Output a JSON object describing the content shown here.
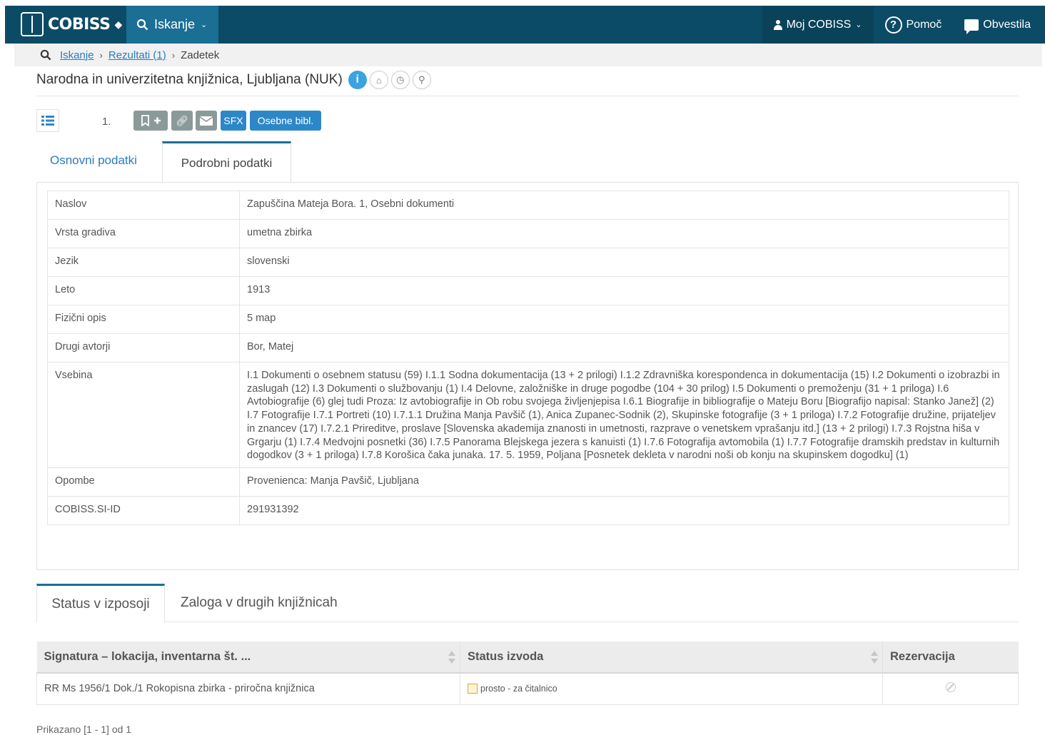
{
  "nav": {
    "brand": "COBISS",
    "search_label": "Iskanje",
    "moj_cobiss": "Moj COBISS",
    "help": "Pomoč",
    "news": "Obvestila"
  },
  "breadcrumb": {
    "items": [
      "Iskanje",
      "Rezultati (1)",
      "Zadetek"
    ]
  },
  "library": {
    "name": "Narodna in univerzitetna knjižnica, Ljubljana (NUK)"
  },
  "toolbar": {
    "record_number": "1.",
    "sfx_label": "SFX",
    "personal_bib_label": "Osebne bibl."
  },
  "tabs": {
    "basic": "Osnovni podatki",
    "detailed": "Podrobni podatki"
  },
  "details": [
    {
      "label": "Naslov",
      "value": "Zapuščina Mateja Bora. 1, Osebni dokumenti"
    },
    {
      "label": "Vrsta gradiva",
      "value": "umetna zbirka"
    },
    {
      "label": "Jezik",
      "value": "slovenski"
    },
    {
      "label": "Leto",
      "value": "1913"
    },
    {
      "label": "Fizični opis",
      "value": "5 map"
    },
    {
      "label": "Drugi avtorji",
      "value": "Bor, Matej"
    },
    {
      "label": "Vsebina",
      "value": "I.1 Dokumenti o osebnem statusu (59) I.1.1 Sodna dokumentacija (13 + 2 prilogi) I.1.2 Zdravniška korespondenca in dokumentacija (15) I.2 Dokumenti o izobrazbi in zaslugah (12) I.3 Dokumenti o službovanju (1) I.4 Delovne, založniške in druge pogodbe (104 + 30 prilog) I.5 Dokumenti o premoženju (31 + 1 priloga) I.6 Avtobiografije (6) glej tudi Proza: Iz avtobiografije in Ob robu svojega življenjepisa I.6.1 Biografije in bibliografije o Mateju Boru [Biografijo napisal: Stanko Janež] (2) I.7 Fotografije I.7.1 Portreti (10) I.7.1.1 Družina Manja Pavšič (1), Anica Zupanec-Sodnik (2), Skupinske fotografije (3 + 1 priloga) I.7.2 Fotografije družine, prijateljev in znancev (17) I.7.2.1 Prireditve, proslave [Slovenska akademija znanosti in umetnosti, razprave o venetskem vprašanju itd.] (13 + 2 prilogi) I.7.3 Rojstna hiša v Grgarju (1) I.7.4 Medvojni posnetki (36) I.7.5 Panorama Blejskega jezera s kanuisti (1) I.7.6 Fotografija avtomobila (1) I.7.7 Fotografije dramskih predstav in kulturnih dogodkov (3 + 1 priloga) I.7.8 Korošica čaka junaka. 17. 5. 1959, Poljana [Posnetek dekleta v narodni noši ob konju na skupinskem dogodku] (1)"
    },
    {
      "label": "Opombe",
      "value": "Provenienca: Manja Pavšič, Ljubljana"
    },
    {
      "label": "COBISS.SI-ID",
      "value": "291931392"
    }
  ],
  "bottom_tabs": {
    "status": "Status v izposoji",
    "other": "Zaloga v drugih knjižnicah"
  },
  "holdings": {
    "headers": [
      "Signatura – lokacija, inventarna št. ...",
      "Status izvoda",
      "Rezervacija"
    ],
    "rows": [
      {
        "signature": "RR Ms 1956/1 Dok./1 Rokopisna zbirka - priročna knjižnica",
        "status": "prosto - za čitalnico"
      }
    ]
  },
  "footer": {
    "shown": "Prikazano [1 - 1] od 1"
  },
  "colors": {
    "nav_bg": "#0c4b66",
    "nav_active": "#1b6e94",
    "link": "#2a7ac0",
    "button_blue": "#2c87c8",
    "button_gray": "#8a9a99"
  }
}
